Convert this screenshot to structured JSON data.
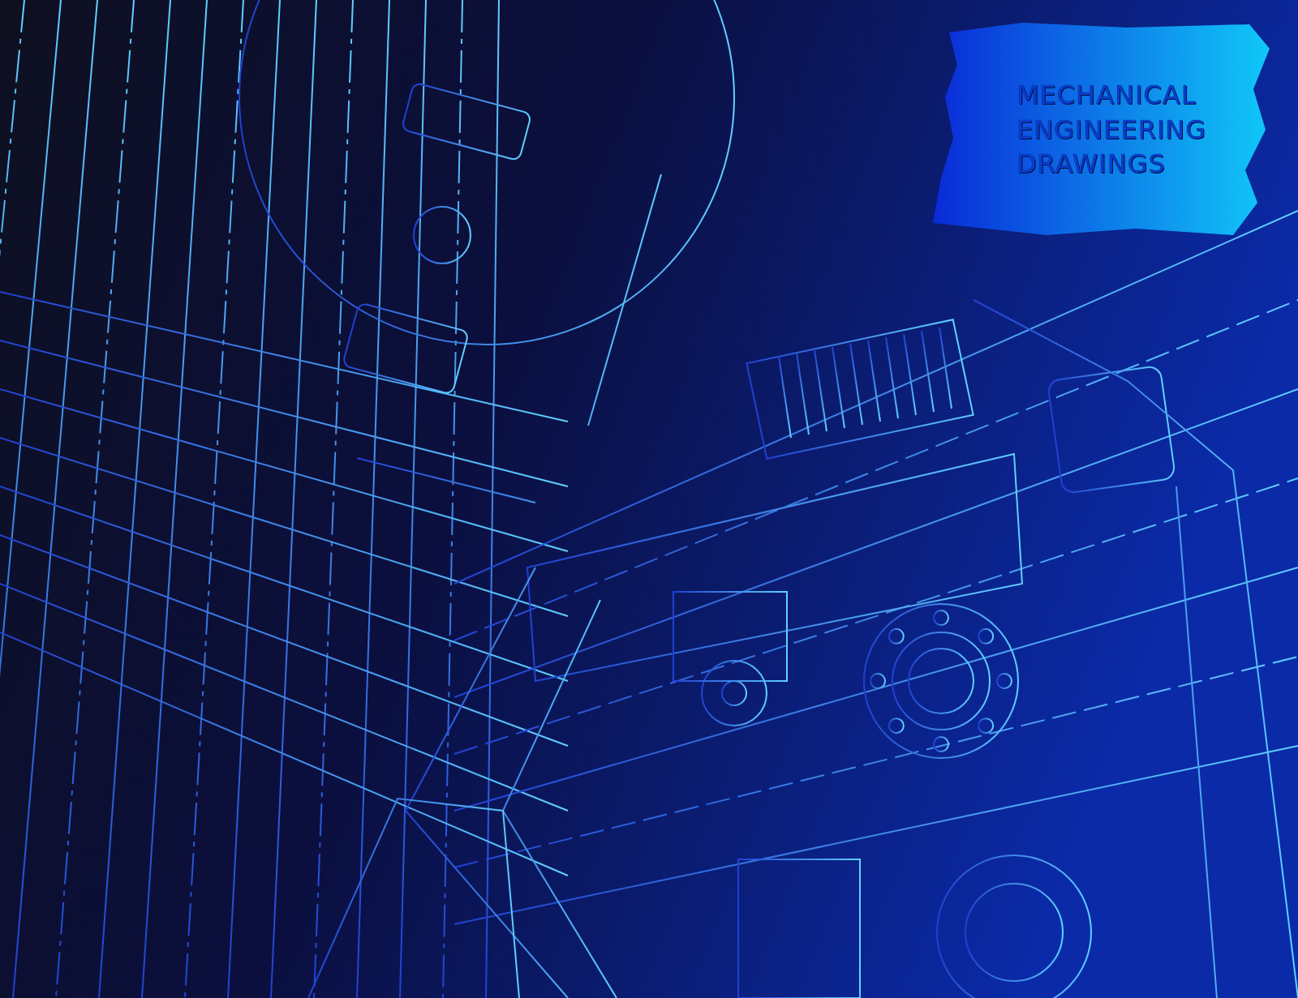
{
  "title_badge": {
    "lines": [
      "MECHANICAL",
      "ENGINEERING",
      "DRAWINGS"
    ]
  }
}
